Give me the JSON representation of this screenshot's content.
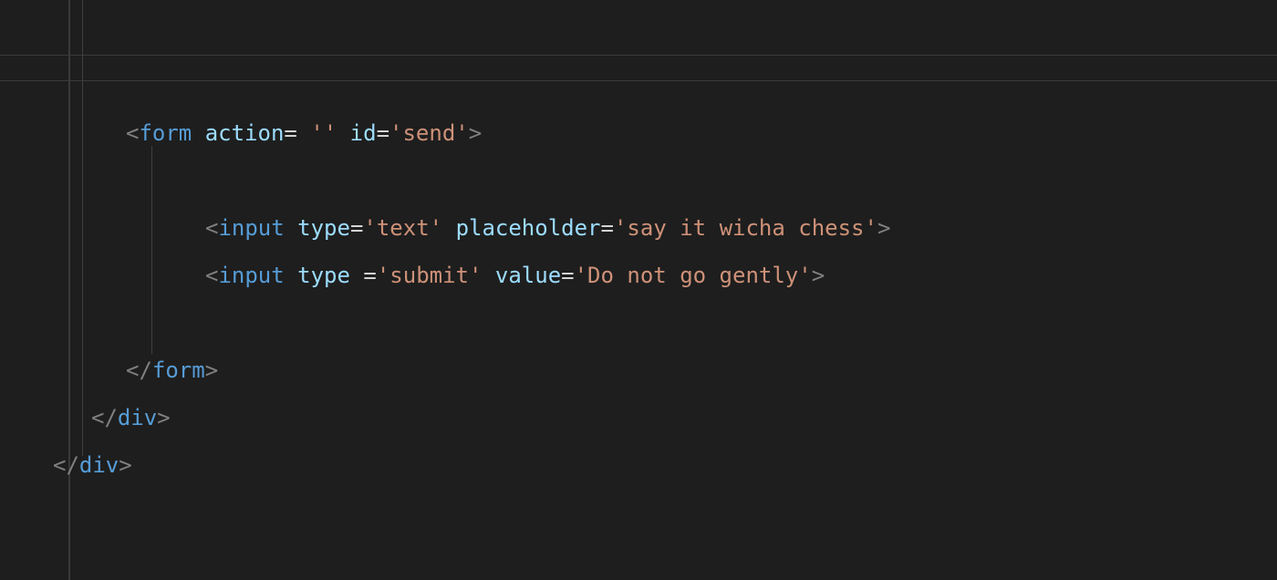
{
  "code": {
    "line1": {
      "open": "<",
      "tag": "form",
      "sp1": " ",
      "attr1": "action",
      "eq1": "=",
      "sp2": " ",
      "val1": "''",
      "sp3": " ",
      "attr2": "id",
      "eq2": "=",
      "val2": "'send'",
      "close": ">"
    },
    "line2": {
      "open": "<",
      "tag": "input",
      "sp1": " ",
      "attr1": "type",
      "eq1": "=",
      "val1": "'text'",
      "sp2": " ",
      "attr2": "placeholder",
      "eq2": "=",
      "val2": "'say it wicha chess'",
      "close": ">"
    },
    "line3": {
      "open": "<",
      "tag": "input",
      "sp1": " ",
      "attr1": "type",
      "sp1b": " ",
      "eq1": "=",
      "val1": "'submit'",
      "sp2": " ",
      "attr2": "value",
      "eq2": "=",
      "val2": "'Do not go gently'",
      "close": ">"
    },
    "line4": {
      "open": "</",
      "tag": "form",
      "close": ">"
    },
    "line5": {
      "open": "</",
      "tag": "div",
      "close": ">"
    },
    "line6": {
      "open": "</",
      "tag": "div",
      "close": ">"
    }
  }
}
